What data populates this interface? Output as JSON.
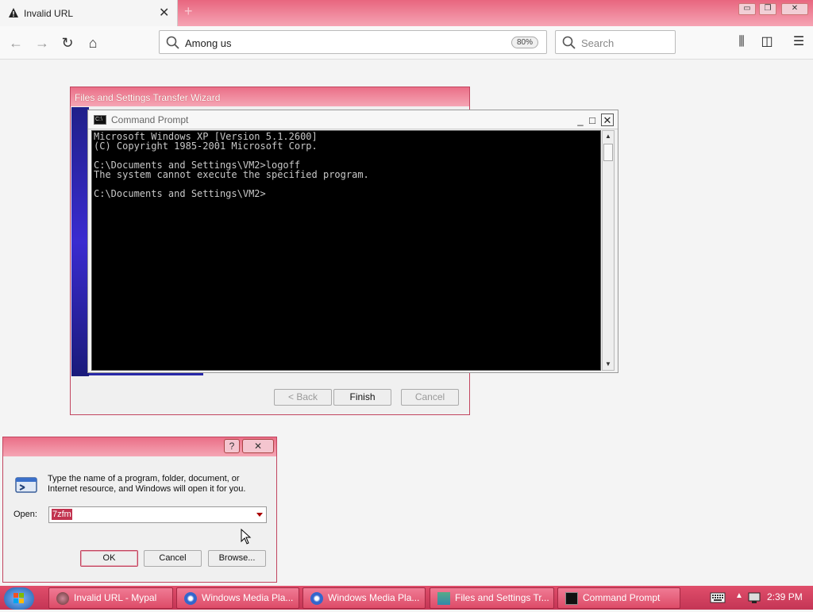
{
  "browser": {
    "tab_title": "Invalid URL",
    "url_text": "Among us",
    "zoom": "80%",
    "search_placeholder": "Search"
  },
  "wizard": {
    "title": "Files and Settings Transfer Wizard",
    "back_label": "< Back",
    "finish_label": "Finish",
    "cancel_label": "Cancel"
  },
  "cmd": {
    "title": "Command Prompt",
    "icon_text": "C:\\",
    "output": "Microsoft Windows XP [Version 5.1.2600]\n(C) Copyright 1985-2001 Microsoft Corp.\n\nC:\\Documents and Settings\\VM2>logoff\nThe system cannot execute the specified program.\n\nC:\\Documents and Settings\\VM2>"
  },
  "run": {
    "description": "Type the name of a program, folder, document, or Internet resource, and Windows will open it for you.",
    "open_label": "Open:",
    "open_value": "7zfm",
    "ok_label": "OK",
    "cancel_label": "Cancel",
    "browse_label": "Browse...",
    "help_label": "?",
    "close_label": "✕"
  },
  "taskbar": {
    "items": [
      {
        "label": "Invalid URL - Mypal"
      },
      {
        "label": "Windows Media Pla..."
      },
      {
        "label": "Windows Media Pla..."
      },
      {
        "label": "Files and Settings Tr..."
      },
      {
        "label": "Command Prompt"
      }
    ],
    "clock": "2:39 PM"
  },
  "colors": {
    "accent": "#e8667f",
    "taskbar": "#d0405c",
    "console_bg": "#000000"
  }
}
